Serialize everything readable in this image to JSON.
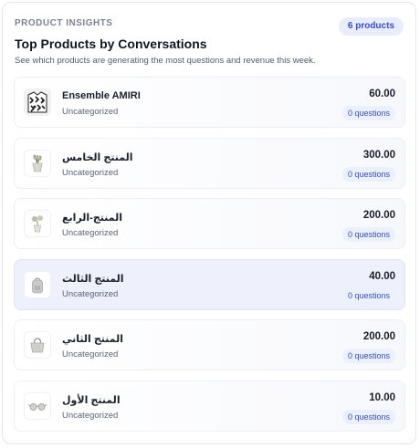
{
  "header": {
    "eyebrow": "PRODUCT INSIGHTS",
    "count_badge": "6 products",
    "title": "Top Products by Conversations",
    "subtitle": "See which products are generating the most questions and revenue this week."
  },
  "products": [
    {
      "name": "Ensemble AMIRI",
      "category": "Uncategorized",
      "price": "60.00",
      "questions": "0 questions",
      "icon": "patterned-garment-icon"
    },
    {
      "name": "المنتج الخامس",
      "category": "Uncategorized",
      "price": "300.00",
      "questions": "0 questions",
      "icon": "plant-pot-icon"
    },
    {
      "name": "المنتج-الرابع",
      "category": "Uncategorized",
      "price": "200.00",
      "questions": "0 questions",
      "icon": "plant-icon"
    },
    {
      "name": "المنتج الثالث",
      "category": "Uncategorized",
      "price": "40.00",
      "questions": "0 questions",
      "icon": "backpack-icon"
    },
    {
      "name": "المنتج الثاني",
      "category": "Uncategorized",
      "price": "200.00",
      "questions": "0 questions",
      "icon": "tote-bag-icon"
    },
    {
      "name": "المنتج الأول",
      "category": "Uncategorized",
      "price": "10.00",
      "questions": "0 questions",
      "icon": "sunglasses-icon"
    }
  ],
  "colors": {
    "accent": "#3a4cc7",
    "badge_bg": "#e9edfb",
    "active_row_bg": "#eef0fb"
  }
}
